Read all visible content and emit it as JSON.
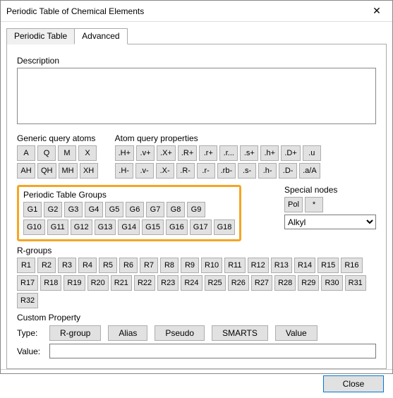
{
  "window": {
    "title": "Periodic Table of Chemical Elements"
  },
  "tabs": {
    "periodic": "Periodic Table",
    "advanced": "Advanced",
    "active": "advanced"
  },
  "sections": {
    "description": "Description",
    "generic": "Generic query atoms",
    "atomq": "Atom query properties",
    "groups": "Periodic Table Groups",
    "special": "Special nodes",
    "rgroups": "R-groups",
    "custom": "Custom Property",
    "type_label": "Type:",
    "value_label": "Value:"
  },
  "generic_row1": [
    "A",
    "Q",
    "M",
    "X"
  ],
  "generic_row2": [
    "AH",
    "QH",
    "MH",
    "XH"
  ],
  "atomq_row1": [
    ".H+",
    ".v+",
    ".X+",
    ".R+",
    ".r+",
    ".r...",
    ".s+",
    ".h+",
    ".D+",
    ".u"
  ],
  "atomq_row2": [
    ".H-",
    ".v-",
    ".X-",
    ".R-",
    ".r-",
    ".rb-",
    ".s-",
    ".h-",
    ".D-",
    ".a/A"
  ],
  "groups_row1": [
    "G1",
    "G2",
    "G3",
    "G4",
    "G5",
    "G6",
    "G7",
    "G8",
    "G9"
  ],
  "groups_row2": [
    "G10",
    "G11",
    "G12",
    "G13",
    "G14",
    "G15",
    "G16",
    "G17",
    "G18"
  ],
  "special_buttons": [
    "Pol",
    "*"
  ],
  "special_dropdown": {
    "selected": "Alkyl"
  },
  "rgroups_row1": [
    "R1",
    "R2",
    "R3",
    "R4",
    "R5",
    "R6",
    "R7",
    "R8",
    "R9",
    "R10",
    "R11",
    "R12",
    "R13",
    "R14",
    "R15",
    "R16"
  ],
  "rgroups_row2": [
    "R17",
    "R18",
    "R19",
    "R20",
    "R21",
    "R22",
    "R23",
    "R24",
    "R25",
    "R26",
    "R27",
    "R28",
    "R29",
    "R30",
    "R31",
    "R32"
  ],
  "custom_types": [
    "R-group",
    "Alias",
    "Pseudo",
    "SMARTS",
    "Value"
  ],
  "value_input": "",
  "footer": {
    "close": "Close"
  }
}
